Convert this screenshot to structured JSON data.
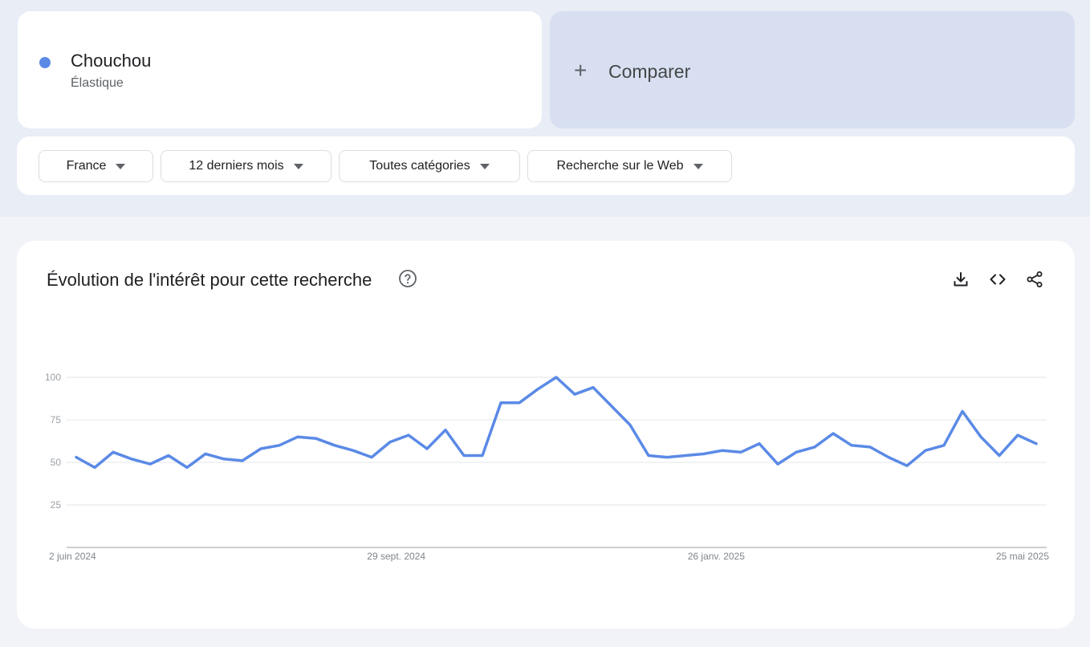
{
  "term": {
    "name": "Chouchou",
    "category": "Élastique",
    "color": "#5b8ae6"
  },
  "compare": {
    "plus": "+",
    "label": "Comparer"
  },
  "filters": {
    "region": "France",
    "period": "12 derniers mois",
    "category": "Toutes catégories",
    "search_type": "Recherche sur le Web"
  },
  "chart": {
    "title": "Évolution de l'intérêt pour cette recherche",
    "icons": [
      "help-icon",
      "download-icon",
      "embed-code-icon",
      "share-icon"
    ]
  },
  "chart_data": {
    "type": "line",
    "title": "Évolution de l'intérêt pour cette recherche",
    "xlabel": "",
    "ylabel": "",
    "ylim": [
      0,
      100
    ],
    "yticks": [
      25,
      50,
      75,
      100
    ],
    "xtick_labels": [
      "2 juin 2024",
      "29 sept. 2024",
      "26 janv. 2025",
      "25 mai 2025"
    ],
    "x_start": "2024-06-02",
    "x_end": "2025-05-25",
    "grid": true,
    "series": [
      {
        "name": "Chouchou",
        "color": "#5b8ae6",
        "values": [
          53,
          47,
          56,
          52,
          49,
          54,
          47,
          55,
          52,
          51,
          58,
          60,
          65,
          64,
          60,
          57,
          53,
          62,
          66,
          58,
          69,
          54,
          54,
          85,
          85,
          93,
          100,
          90,
          94,
          83,
          72,
          54,
          53,
          54,
          55,
          57,
          56,
          61,
          49,
          56,
          59,
          67,
          60,
          59,
          53,
          48,
          57,
          60,
          80,
          65,
          54,
          66,
          61
        ]
      }
    ]
  }
}
